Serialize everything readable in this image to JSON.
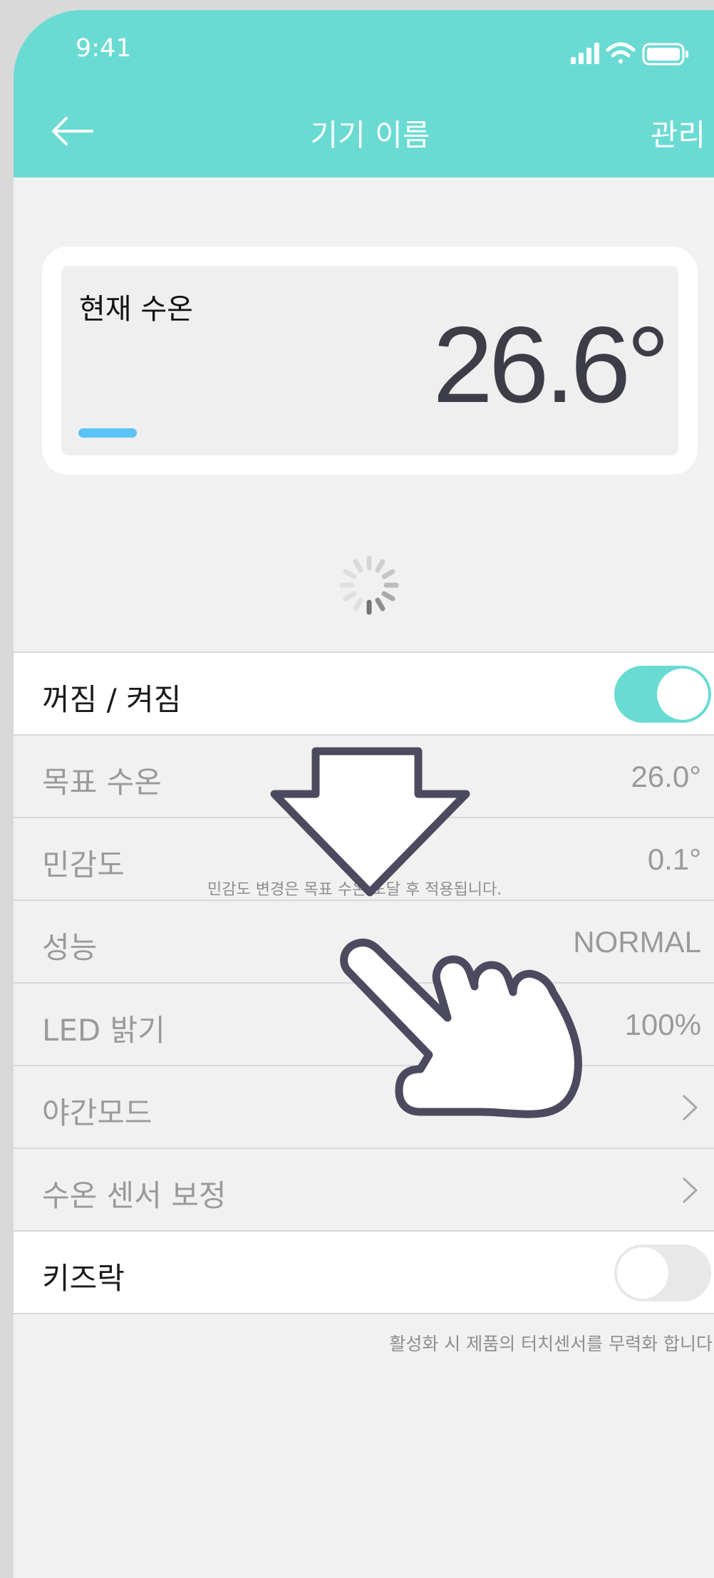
{
  "status_bar": {
    "time": "9:41",
    "icons": [
      "signal-icon",
      "wifi-icon",
      "battery-icon"
    ]
  },
  "header": {
    "title": "기기 이름",
    "manage_label": "관리",
    "back_icon": "back-arrow-icon",
    "color": "#6adbd3"
  },
  "temperature_card": {
    "label": "현재 수온",
    "value": "26.6°",
    "bar_color": "#5bc3f5"
  },
  "settings": {
    "power": {
      "label": "꺼짐 / 켜짐",
      "state": "on"
    },
    "target_temp": {
      "label": "목표 수온",
      "value": "26.0°"
    },
    "sensitivity": {
      "label": "민감도",
      "value": "0.1°",
      "note": "민감도 변경은 목표 수온 도달 후 적용됩니다."
    },
    "performance": {
      "label": "성능",
      "value": "NORMAL"
    },
    "led": {
      "label": "LED 밝기",
      "value": "100%"
    },
    "night_mode": {
      "label": "야간모드"
    },
    "sensor_calibration": {
      "label": "수온 센서 보정"
    },
    "kids_lock": {
      "label": "키즈락",
      "state": "off"
    }
  },
  "footer_note": "활성화 시 제품의 터치센서를 무력화 합니다.",
  "overlay": {
    "icons": [
      "down-arrow-icon",
      "pointing-hand-icon"
    ]
  }
}
